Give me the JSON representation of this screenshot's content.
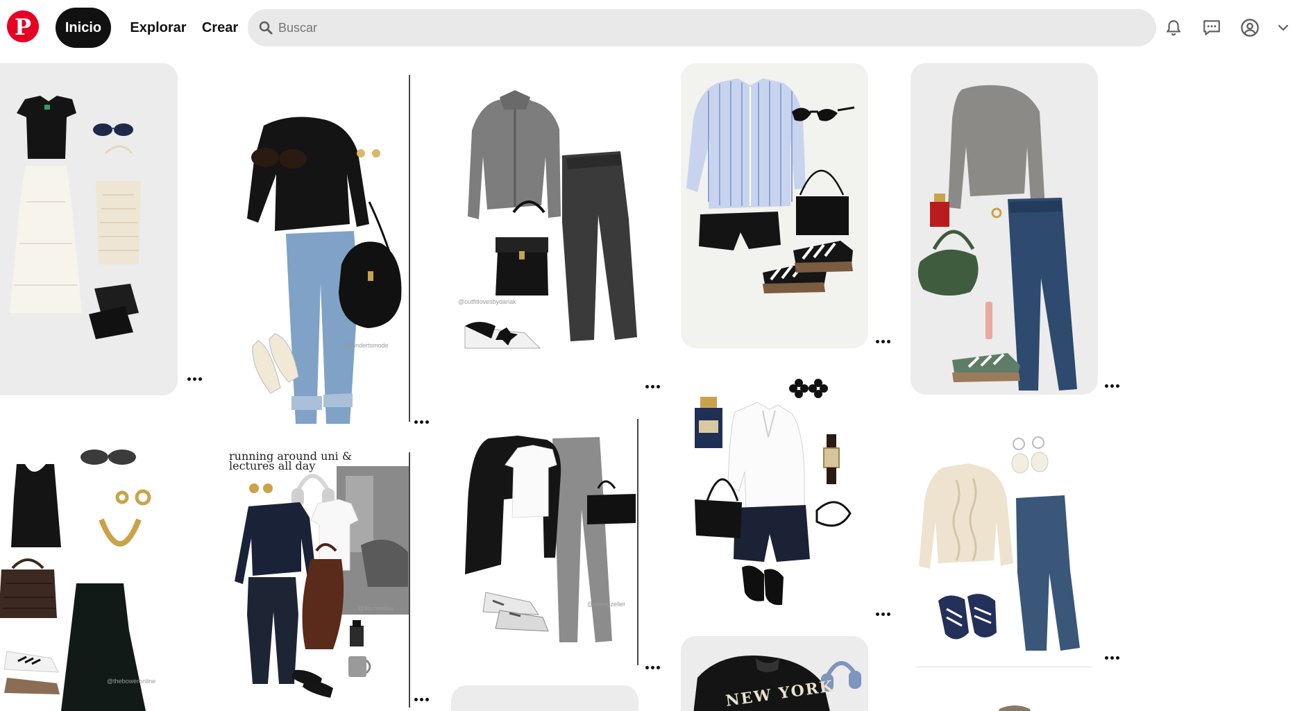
{
  "nav": {
    "home": "Inicio",
    "explore": "Explorar",
    "create": "Crear"
  },
  "search": {
    "placeholder": "Buscar"
  },
  "icons": {
    "logo": "pinterest-logo",
    "search": "search-icon",
    "notifications": "bell-icon",
    "messages": "chat-icon",
    "profile": "profile-icon",
    "account_menu": "chevron-down-icon",
    "pin_options": "more-options-icon"
  },
  "colors": {
    "brand": "#e60023",
    "active_nav": "#111111",
    "search_bg": "#e9e9e9"
  },
  "pins": {
    "p6_caption": "running around uni &\nlectures all day",
    "p2_watermark": "@bindertsmode",
    "p3_watermark": "@outfitlovesbydariak",
    "p8_watermark": "@onesgzeller",
    "p6_watermark": "@fitsmeelou",
    "p5_watermark": "@theboweronline",
    "p12_text": "NEW YORK"
  }
}
